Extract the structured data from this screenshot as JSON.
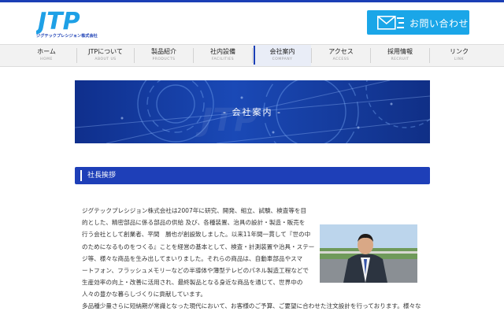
{
  "header": {
    "logo_text": "JTP",
    "logo_subtitle": "ジグテックプレシジョン株式会社",
    "contact_label": "お問い合わせ"
  },
  "nav": [
    {
      "jp": "ホーム",
      "en": "HOME"
    },
    {
      "jp": "JTPについて",
      "en": "ABOUT US"
    },
    {
      "jp": "製品紹介",
      "en": "PRODUCTS"
    },
    {
      "jp": "社内設備",
      "en": "FACILITIES"
    },
    {
      "jp": "会社案内",
      "en": "COMPANY"
    },
    {
      "jp": "アクセス",
      "en": "ACCESS"
    },
    {
      "jp": "採用情報",
      "en": "RECRUIT"
    },
    {
      "jp": "リンク",
      "en": "LINK"
    }
  ],
  "hero": {
    "title": "- 会社案内 -"
  },
  "section": {
    "title": "社長挨拶"
  },
  "greeting": {
    "lines": [
      "ジグテックプレシジョン株式会社は2007年に研究、開発、組立、試験、検査等を目",
      "的とした、精密部品に係る部品の供給 及び、各種装置、治具の設計・製造・販売を",
      "行う会社として創業者、平間　勝也が創設致しました。以来11年間一貫して『世の中",
      "のためになるものをつくる』ことを経営の基本として、検査・計測装置や治具・ステー",
      "ジ等、様々な商品を生み出してまいりました。それらの商品は、自動車部品やスマ",
      "ートフォン、フラッシュメモリーなどの半導体や薄型テレビのパネル製造工程などで",
      "生産効率の向上・改善に活用され、最終製品となる身近な商品を通じて、世界中の",
      "人々の豊かな暮らしづくりに貢献しています。"
    ],
    "wide_line": "多品種少量さらに短納期が常識となった現代において、お客様のご予算、ご要望に合わせた注文設計を行っております。様々な"
  }
}
